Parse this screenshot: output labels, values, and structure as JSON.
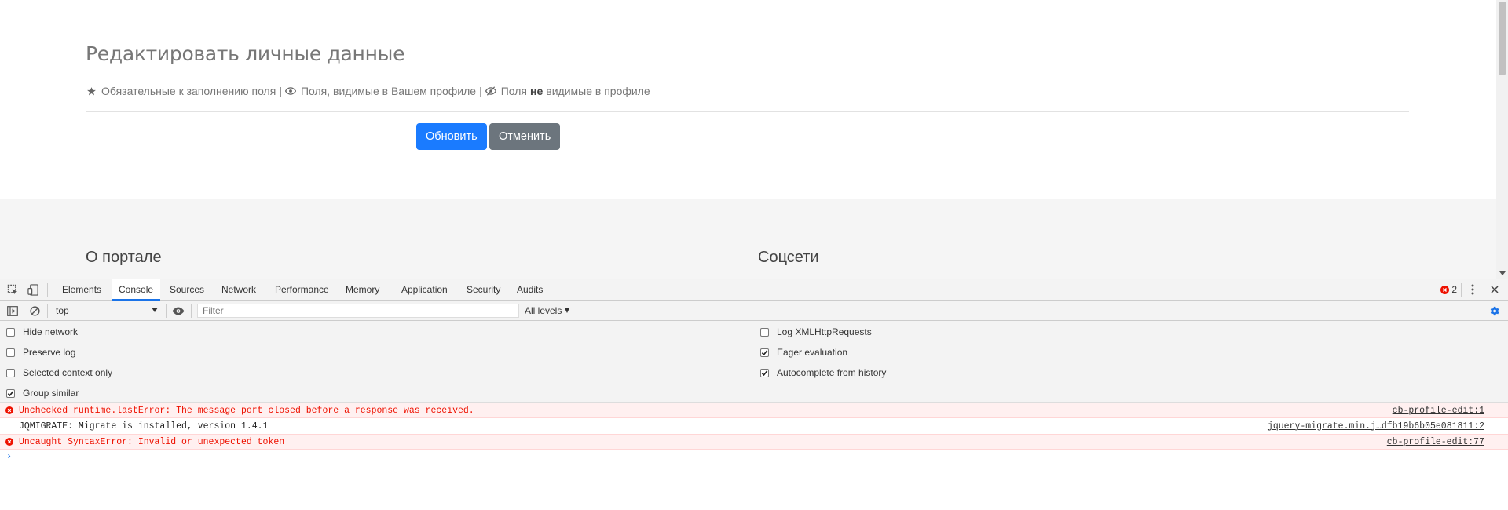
{
  "page": {
    "title": "Редактировать личные данные",
    "legend": {
      "required": "Обязательные к заполнению поля",
      "sep1": "|",
      "visible": "Поля, видимые в Вашем профиле",
      "sep2": "|",
      "not_visible_pre": "Поля",
      "not_visible_bold": "не",
      "not_visible_post": "видимые в профиле"
    },
    "update_button": "Обновить",
    "cancel_button": "Отменить",
    "footer": {
      "about": "О портале",
      "social": "Соцсети"
    }
  },
  "devtools": {
    "tabs": [
      "Elements",
      "Console",
      "Sources",
      "Network",
      "Performance",
      "Memory",
      "Application",
      "Security",
      "Audits"
    ],
    "active_tab": "Console",
    "error_count": "2",
    "context": "top",
    "filter_placeholder": "Filter",
    "levels": "All levels",
    "settings_left": [
      {
        "label": "Hide network",
        "checked": false
      },
      {
        "label": "Preserve log",
        "checked": false
      },
      {
        "label": "Selected context only",
        "checked": false
      },
      {
        "label": "Group similar",
        "checked": true
      }
    ],
    "settings_right": [
      {
        "label": "Log XMLHttpRequests",
        "checked": false
      },
      {
        "label": "Eager evaluation",
        "checked": true
      },
      {
        "label": "Autocomplete from history",
        "checked": true
      }
    ],
    "messages": [
      {
        "type": "error",
        "text": "Unchecked runtime.lastError: The message port closed before a response was received.",
        "source": "cb-profile-edit:1"
      },
      {
        "type": "log",
        "text": "JQMIGRATE: Migrate is installed, version 1.4.1",
        "source": "jquery-migrate.min.j…dfb19b6b05e081811:2"
      },
      {
        "type": "error",
        "text": "Uncaught SyntaxError: Invalid or unexpected token",
        "source": "cb-profile-edit:77"
      }
    ],
    "prompt": "›"
  },
  "colors": {
    "primary": "#1a7bff",
    "secondary": "#6c757d",
    "error": "#ee1100",
    "devtools_accent": "#1a73e8"
  }
}
